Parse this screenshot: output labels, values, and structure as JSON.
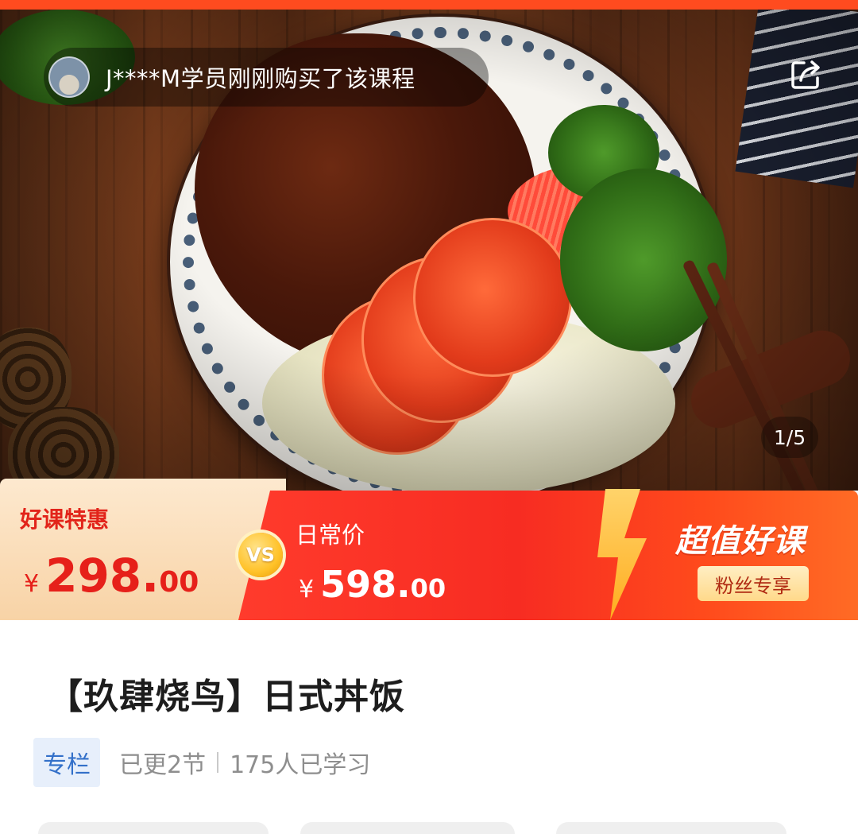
{
  "purchase_notice": "J****M学员刚刚购买了该课程",
  "carousel": {
    "counter": "1/5"
  },
  "icons": {
    "share": "share-icon",
    "avatar": "avatar",
    "vs": "vs-badge",
    "bolt": "lightning-bolt-icon"
  },
  "price": {
    "deal_label": "好课特惠",
    "deal_currency": "¥",
    "deal_int": "298.",
    "deal_dec": "00",
    "vs": "VS",
    "normal_label": "日常价",
    "normal_currency": "¥",
    "normal_int": "598.",
    "normal_dec": "00",
    "promo_title": "超值好课",
    "promo_tag": "粉丝专享"
  },
  "course": {
    "title": "【玖肆烧鸟】日式丼饭",
    "type_tag": "专栏",
    "updates": "已更2节",
    "learners": "175人已学习"
  },
  "colors": {
    "accent": "#ff3b2c",
    "deal_red": "#e6201a",
    "tag_blue": "#3370c9",
    "tag_bg": "#e7effb",
    "gold": "#ffc229"
  }
}
